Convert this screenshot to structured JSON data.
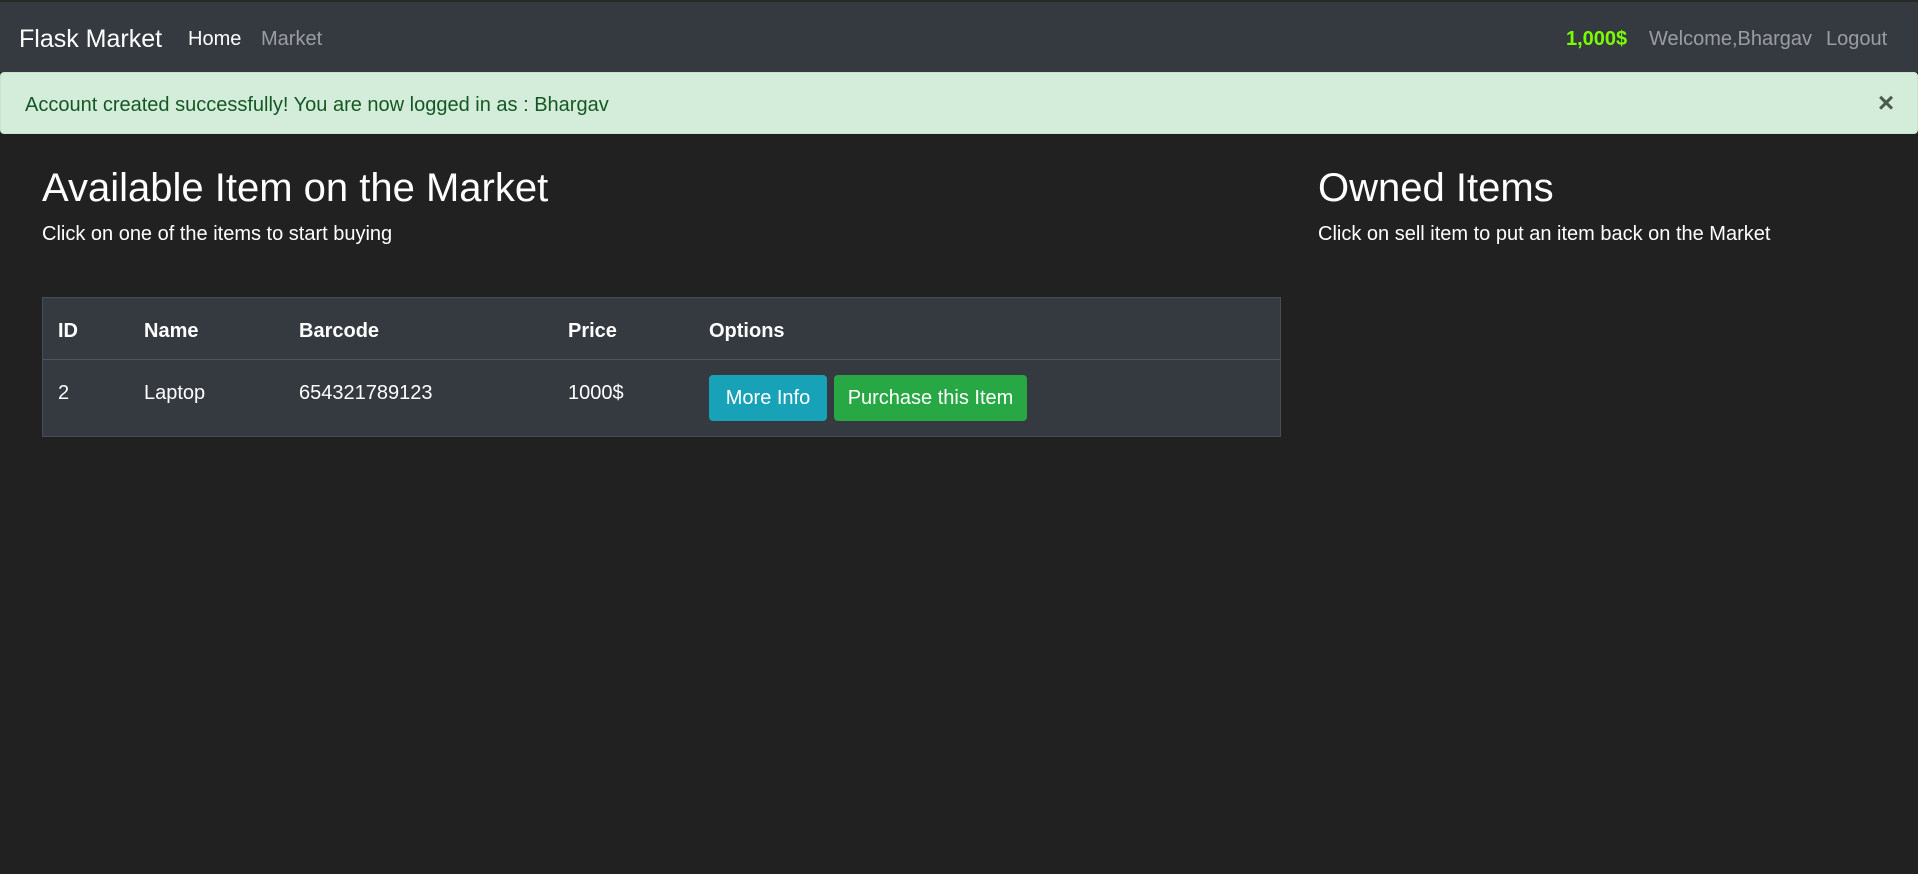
{
  "navbar": {
    "brand": "Flask Market",
    "links": [
      {
        "label": "Home",
        "active": true
      },
      {
        "label": "Market",
        "active": false
      }
    ],
    "budget": "1,000$",
    "welcome": "Welcome,Bhargav",
    "logout": "Logout"
  },
  "alert": {
    "message": "Account created successfully! You are now logged in as : Bhargav",
    "close_icon": "×"
  },
  "market": {
    "title": "Available Item on the Market",
    "subtitle": "Click on one of the items to start buying",
    "table": {
      "headers": [
        "ID",
        "Name",
        "Barcode",
        "Price",
        "Options"
      ],
      "rows": [
        {
          "id": "2",
          "name": "Laptop",
          "barcode": "654321789123",
          "price": "1000$",
          "more_info_label": "More Info",
          "purchase_label": "Purchase this Item"
        }
      ]
    }
  },
  "owned": {
    "title": "Owned Items",
    "subtitle": "Click on sell item to put an item back on the Market"
  },
  "colors": {
    "page_background": "#212121",
    "navbar_background": "#343a40",
    "budget": "#7cfc00",
    "alert_background": "#d4edda",
    "alert_text": "#155724",
    "info_button": "#17a2b8",
    "success_button": "#28a745"
  }
}
